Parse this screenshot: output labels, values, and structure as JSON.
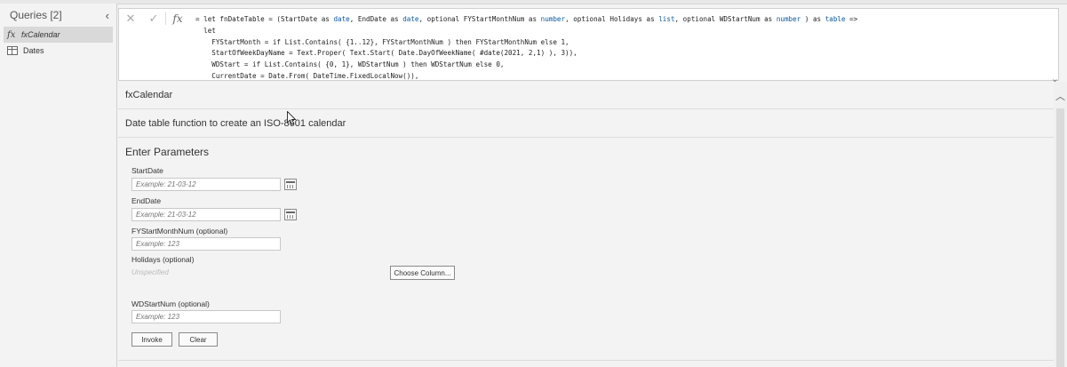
{
  "queries": {
    "header": "Queries [2]",
    "items": [
      {
        "icon": "function-icon",
        "label": "fxCalendar",
        "selected": true
      },
      {
        "icon": "table-icon",
        "label": "Dates",
        "selected": false
      }
    ]
  },
  "formula_bar": {
    "cancel_glyph": "✕",
    "commit_glyph": "✓",
    "fx_glyph": "fx",
    "lines": [
      "= let fnDateTable = (StartDate as date, EndDate as date, optional FYStartMonthNum as number, optional Holidays as list, optional WDStartNum as number ) as table =>",
      "  let",
      "    FYStartMonth = if List.Contains( {1..12}, FYStartMonthNum ) then FYStartMonthNum else 1,",
      "    StartOfWeekDayName = Text.Proper( Text.Start( Date.DayOfWeekName( #date(2021, 2,1) ), 3)),",
      "    WDStart = if List.Contains( {0, 1}, WDStartNum ) then WDStartNum else 0,",
      "    CurrentDate = Date.From( DateTime.FixedLocalNow()),"
    ]
  },
  "function": {
    "name": "fxCalendar",
    "description": "Date table function to create an ISO-8601 calendar",
    "section_title": "Enter Parameters"
  },
  "params": {
    "start_date": {
      "label": "StartDate",
      "placeholder": "Example: 21-03-12"
    },
    "end_date": {
      "label": "EndDate",
      "placeholder": "Example: 21-03-12"
    },
    "fy_start": {
      "label": "FYStartMonthNum (optional)",
      "placeholder": "Example: 123"
    },
    "holidays": {
      "label": "Holidays (optional)",
      "value": "Unspecified",
      "button": "Choose Column..."
    },
    "wd_start": {
      "label": "WDStartNum (optional)",
      "placeholder": "Example: 123"
    }
  },
  "actions": {
    "invoke": "Invoke",
    "clear": "Clear"
  },
  "colors": {
    "keyword": "#0c5aa3",
    "background": "#f3f3f3",
    "selected_item": "#d9d9d9"
  }
}
